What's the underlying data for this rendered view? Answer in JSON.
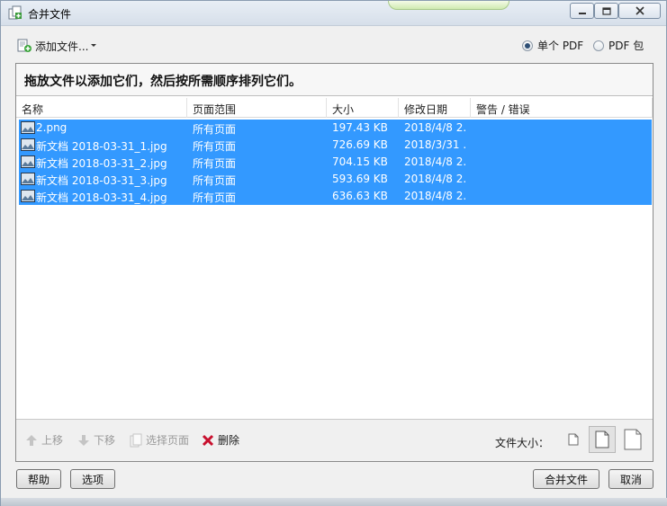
{
  "window": {
    "title": "合并文件",
    "minimize_label": "▭",
    "maximize_label": "□",
    "close_label": "✕"
  },
  "toolbar": {
    "add_files_label": "添加文件...",
    "output_mode": {
      "single_pdf_label": "单个 PDF",
      "pdf_package_label": "PDF 包",
      "selected": "single_pdf"
    }
  },
  "panel": {
    "hint": "拖放文件以添加它们，然后按所需顺序排列它们。",
    "columns": [
      "名称",
      "页面范围",
      "大小",
      "修改日期",
      "警告 / 错误"
    ],
    "rows": [
      {
        "name": "2.png",
        "range": "所有页面",
        "size": "197.43 KB",
        "date": "2018/4/8 2...",
        "warning": ""
      },
      {
        "name": "新文档 2018-03-31_1.jpg",
        "range": "所有页面",
        "size": "726.69 KB",
        "date": "2018/3/31 ...",
        "warning": ""
      },
      {
        "name": "新文档 2018-03-31_2.jpg",
        "range": "所有页面",
        "size": "704.15 KB",
        "date": "2018/4/8 2...",
        "warning": ""
      },
      {
        "name": "新文档 2018-03-31_3.jpg",
        "range": "所有页面",
        "size": "593.69 KB",
        "date": "2018/4/8 2...",
        "warning": ""
      },
      {
        "name": "新文档 2018-03-31_4.jpg",
        "range": "所有页面",
        "size": "636.63 KB",
        "date": "2018/4/8 2...",
        "warning": ""
      }
    ]
  },
  "bottom_tools": {
    "move_up_label": "上移",
    "move_down_label": "下移",
    "select_pages_label": "选择页面",
    "delete_label": "删除",
    "file_size_label": "文件大小："
  },
  "buttons": {
    "help_label": "帮助",
    "options_label": "选项",
    "merge_label": "合并文件",
    "cancel_label": "取消"
  },
  "colors": {
    "selection": "#3399ff",
    "delete_icon": "#c8102e"
  }
}
